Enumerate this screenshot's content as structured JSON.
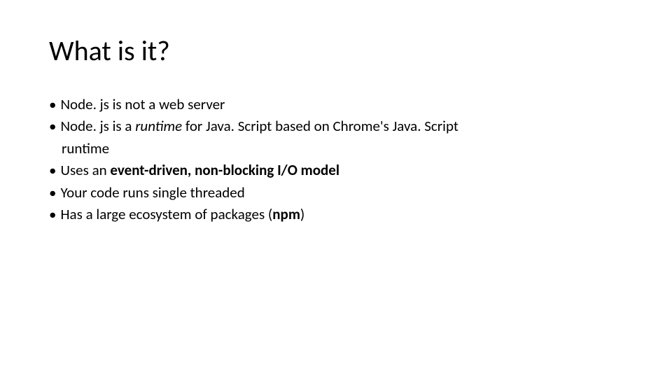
{
  "title": "What is it?",
  "bullets": {
    "b0": {
      "marker": "•",
      "text": "Node. js is not a web server"
    },
    "b1": {
      "marker": "•",
      "prefix": "Node. js is a ",
      "italic": "runtime",
      "suffix": " for Java. Script based on Chrome's Java. Script",
      "cont": "runtime"
    },
    "b2": {
      "marker": "•",
      "prefix": "Uses an ",
      "bold": "event-driven, non-blocking I/O model"
    },
    "b3": {
      "marker": "•",
      "text": "Your code runs single threaded"
    },
    "b4": {
      "marker": "•",
      "prefix": "Has a large ecosystem of packages (",
      "bold": "npm",
      "suffix": ")"
    }
  }
}
